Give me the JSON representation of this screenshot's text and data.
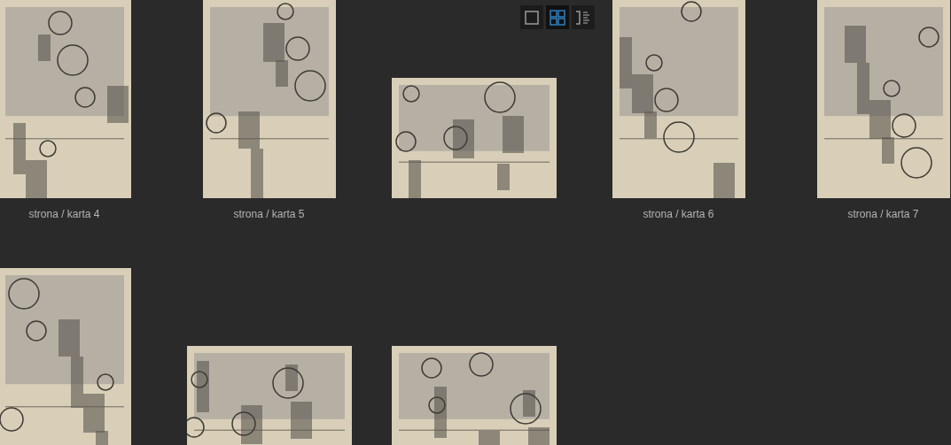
{
  "view_buttons": [
    {
      "kind": "single",
      "selected": false
    },
    {
      "kind": "grid",
      "selected": true
    },
    {
      "kind": "list",
      "selected": false
    }
  ],
  "rows": [
    {
      "items": [
        {
          "kind": "page",
          "label": "strona / karta 4"
        },
        {
          "kind": "page",
          "label": "strona / karta 5"
        },
        {
          "kind": "spread"
        },
        {
          "kind": "page",
          "label": "strona / karta 6"
        },
        {
          "kind": "page",
          "label": "strona / karta 7"
        }
      ]
    },
    {
      "items": [
        {
          "kind": "page"
        },
        {
          "kind": "spread"
        },
        {
          "kind": "spread"
        }
      ]
    }
  ]
}
